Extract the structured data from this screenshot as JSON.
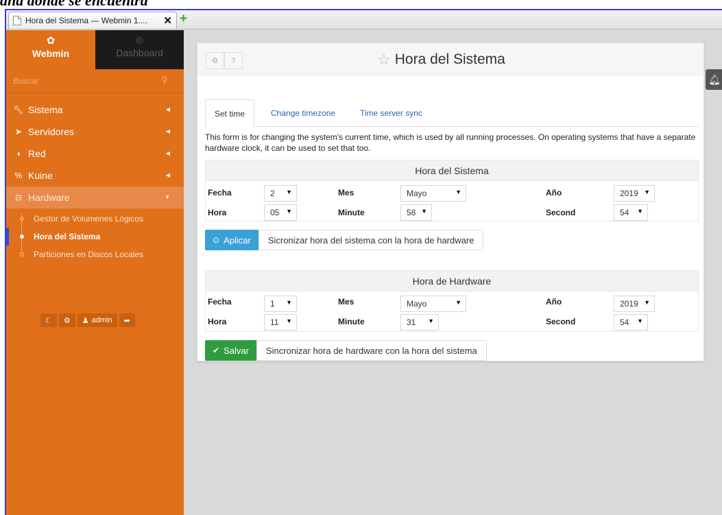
{
  "top_text": "ana donde se encuentra",
  "browser": {
    "tab_title": "Hora del Sistema — Webmin 1....",
    "close_glyph": "✕",
    "new_tab_glyph": "+"
  },
  "sidebar": {
    "webmin_label": "Webmin",
    "dashboard_label": "Dashboard",
    "search_placeholder": "Buscar",
    "menu": [
      {
        "label": "Sistema",
        "icon": "wrench-icon"
      },
      {
        "label": "Servidores",
        "icon": "rocket-icon"
      },
      {
        "label": "Red",
        "icon": "shield-icon"
      },
      {
        "label": "Kuine",
        "icon": "link-icon"
      },
      {
        "label": "Hardware",
        "icon": "hdd-icon"
      }
    ],
    "hardware_items": [
      {
        "label": "Gestor de Volumenes Lógicos"
      },
      {
        "label": "Hora del Sistema"
      },
      {
        "label": "Particiones en Discos Locales"
      }
    ],
    "footer": {
      "user_label": "admin"
    }
  },
  "panel": {
    "title": "Hora del Sistema",
    "tabs": [
      {
        "label": "Set time"
      },
      {
        "label": "Change timezone"
      },
      {
        "label": "Time server sync"
      }
    ],
    "description": "This form is for changing the system's current time, which is used by all running processes. On operating systems that have a separate hardware clock, it can be used to set that too.",
    "labels": {
      "date": "Fecha",
      "month": "Mes",
      "year": "Año",
      "hour": "Hora",
      "minute": "Minute",
      "second": "Second"
    },
    "system": {
      "heading": "Hora del Sistema",
      "date": "2",
      "month": "Mayo",
      "year": "2019",
      "hour": "05",
      "minute": "58",
      "second": "54",
      "apply_label": "Aplicar",
      "sync_label": "Sicronizar hora del sistema con la hora de hardware"
    },
    "hardware": {
      "heading": "Hora de Hardware",
      "date": "1",
      "month": "Mayo",
      "year": "2019",
      "hour": "11",
      "minute": "31",
      "second": "54",
      "save_label": "Salvar",
      "sync_label": "Sincronizar hora de hardware con la hora del sistema"
    }
  },
  "colors": {
    "sidebar": "#e0701a",
    "apply_button": "#3aa1d6",
    "save_button": "#2f9d3f",
    "link": "#2a63b5"
  }
}
